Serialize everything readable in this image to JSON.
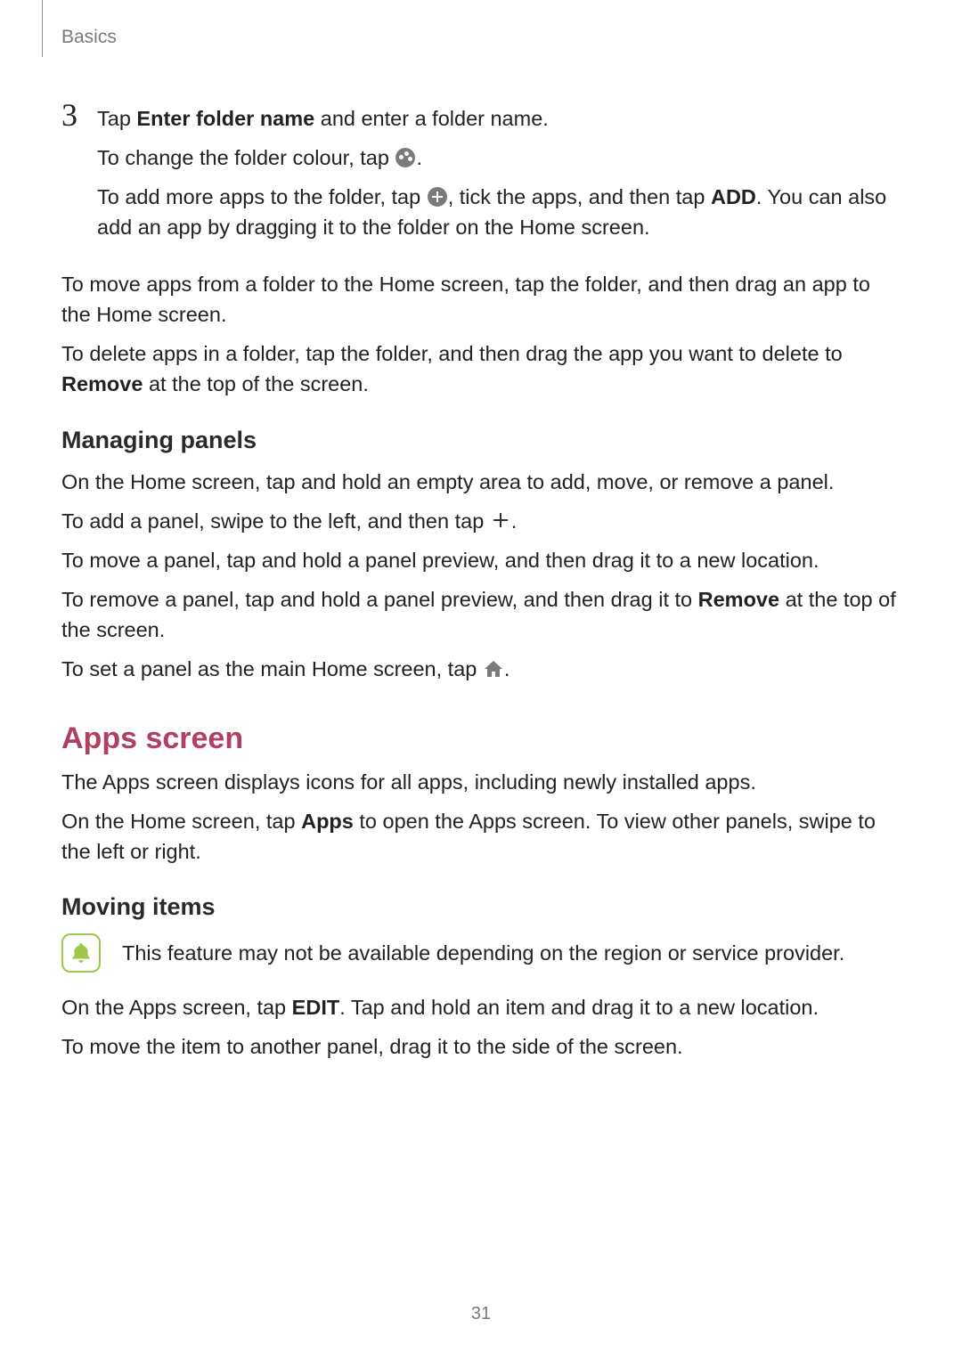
{
  "header": {
    "section": "Basics"
  },
  "step": {
    "number": "3",
    "line1_pre": "Tap ",
    "line1_bold": "Enter folder name",
    "line1_post": " and enter a folder name.",
    "line2_pre": "To change the folder colour, tap ",
    "line2_post": ".",
    "line3_pre": "To add more apps to the folder, tap ",
    "line3_mid": ", tick the apps, and then tap ",
    "line3_bold": "ADD",
    "line3_post": ". You can also add an app by dragging it to the folder on the Home screen."
  },
  "para_move_out": "To move apps from a folder to the Home screen, tap the folder, and then drag an app to the Home screen.",
  "para_delete_pre": "To delete apps in a folder, tap the folder, and then drag the app you want to delete to ",
  "para_delete_bold": "Remove",
  "para_delete_post": " at the top of the screen.",
  "managing": {
    "heading": "Managing panels",
    "p1": "On the Home screen, tap and hold an empty area to add, move, or remove a panel.",
    "p2_pre": "To add a panel, swipe to the left, and then tap ",
    "p2_post": ".",
    "p3": "To move a panel, tap and hold a panel preview, and then drag it to a new location.",
    "p4_pre": "To remove a panel, tap and hold a panel preview, and then drag it to ",
    "p4_bold": "Remove",
    "p4_post": " at the top of the screen.",
    "p5_pre": "To set a panel as the main Home screen, tap ",
    "p5_post": "."
  },
  "apps": {
    "heading": "Apps screen",
    "p1": "The Apps screen displays icons for all apps, including newly installed apps.",
    "p2_pre": "On the Home screen, tap ",
    "p2_bold": "Apps",
    "p2_post": " to open the Apps screen. To view other panels, swipe to the left or right."
  },
  "moving": {
    "heading": "Moving items",
    "note": "This feature may not be available depending on the region or service provider.",
    "p1_pre": "On the Apps screen, tap ",
    "p1_bold": "EDIT",
    "p1_post": ". Tap and hold an item and drag it to a new location.",
    "p2": "To move the item to another panel, drag it to the side of the screen."
  },
  "page_number": "31"
}
